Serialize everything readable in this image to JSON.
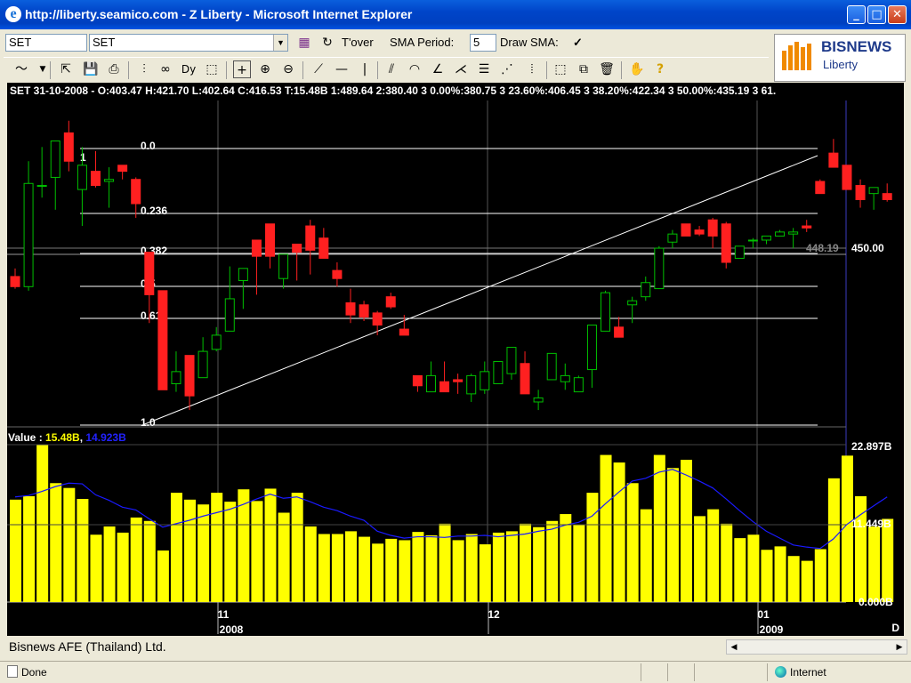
{
  "window": {
    "title": "http://liberty.seamico.com - Z Liberty - Microsoft Internet Explorer"
  },
  "toolbar": {
    "symbol_input": "SET",
    "symbol_select": "SET",
    "tover_label": "T'over",
    "sma_period_label": "SMA Period:",
    "sma_period_value": "5",
    "draw_sma_label": "Draw SMA:",
    "draw_sma_checked": "✓"
  },
  "logo": {
    "brand": "BISNEWS",
    "sub": "Liberty"
  },
  "info_line": "SET 31-10-2008 - O:403.47 H:421.70 L:402.64 C:416.53 T:15.48B 1:489.64 2:380.40 3 0.00%:380.75 3 23.60%:406.45 3 38.20%:422.34 3 50.00%:435.19 3 61.",
  "fib_labels": [
    "0.0",
    "0.236",
    "0.382",
    "0.5",
    "0.618",
    "1.0"
  ],
  "fib_marker": "1",
  "cursor_value": "448.19",
  "price_axis_label": "450.00",
  "volume": {
    "legend_prefix": "Value : ",
    "value": "15.48B",
    "sma": "14.923B",
    "axis_labels": [
      "22.897B",
      "11.449B",
      "0.000B"
    ]
  },
  "x_axis": {
    "ticks": [
      "11",
      "12",
      "01"
    ],
    "years": [
      "2008",
      "2009"
    ],
    "end_label": "D"
  },
  "chart_data": {
    "type": "candlestick",
    "candles": [
      {
        "o": 423,
        "h": 427,
        "l": 417,
        "c": 418
      },
      {
        "o": 418,
        "h": 480,
        "l": 416,
        "c": 469
      },
      {
        "o": 468,
        "h": 487,
        "l": 462,
        "c": 468
      },
      {
        "o": 472,
        "h": 482,
        "l": 456,
        "c": 490
      },
      {
        "o": 494,
        "h": 500,
        "l": 475,
        "c": 480
      },
      {
        "o": 466,
        "h": 487,
        "l": 448,
        "c": 478
      },
      {
        "o": 475,
        "h": 485,
        "l": 467,
        "c": 468
      },
      {
        "o": 470,
        "h": 477,
        "l": 457,
        "c": 471
      },
      {
        "o": 478,
        "h": 478,
        "l": 471,
        "c": 475
      },
      {
        "o": 471,
        "h": 472,
        "l": 452,
        "c": 459
      },
      {
        "o": 435,
        "h": 435,
        "l": 400,
        "c": 414
      },
      {
        "o": 416,
        "h": 416,
        "l": 396,
        "c": 367
      },
      {
        "o": 370,
        "h": 386,
        "l": 366,
        "c": 376
      },
      {
        "o": 384,
        "h": 384,
        "l": 357,
        "c": 364
      },
      {
        "o": 373,
        "h": 393,
        "l": 373,
        "c": 386
      },
      {
        "o": 387,
        "h": 398,
        "l": 386,
        "c": 394
      },
      {
        "o": 396,
        "h": 428,
        "l": 396,
        "c": 412
      },
      {
        "o": 421,
        "h": 427,
        "l": 407,
        "c": 427
      },
      {
        "o": 441,
        "h": 441,
        "l": 414,
        "c": 433
      },
      {
        "o": 449,
        "h": 449,
        "l": 427,
        "c": 433
      },
      {
        "o": 422,
        "h": 427,
        "l": 417,
        "c": 434
      },
      {
        "o": 439,
        "h": 439,
        "l": 421,
        "c": 435
      },
      {
        "o": 448,
        "h": 451,
        "l": 424,
        "c": 436
      },
      {
        "o": 442,
        "h": 447,
        "l": 434,
        "c": 432
      },
      {
        "o": 426,
        "h": 430,
        "l": 418,
        "c": 422
      },
      {
        "o": 410,
        "h": 417,
        "l": 400,
        "c": 404
      },
      {
        "o": 409,
        "h": 411,
        "l": 401,
        "c": 403
      },
      {
        "o": 405,
        "h": 406,
        "l": 394,
        "c": 399
      },
      {
        "o": 413,
        "h": 415,
        "l": 407,
        "c": 408
      },
      {
        "o": 397,
        "h": 404,
        "l": 396,
        "c": 394
      },
      {
        "o": 374,
        "h": 374,
        "l": 366,
        "c": 369
      },
      {
        "o": 366,
        "h": 381,
        "l": 366,
        "c": 374
      },
      {
        "o": 371,
        "h": 381,
        "l": 369,
        "c": 366
      },
      {
        "o": 372,
        "h": 375,
        "l": 365,
        "c": 371
      },
      {
        "o": 365,
        "h": 375,
        "l": 361,
        "c": 374
      },
      {
        "o": 367,
        "h": 381,
        "l": 365,
        "c": 376
      },
      {
        "o": 370,
        "h": 381,
        "l": 370,
        "c": 381
      },
      {
        "o": 375,
        "h": 385,
        "l": 372,
        "c": 388
      },
      {
        "o": 380,
        "h": 386,
        "l": 371,
        "c": 365
      },
      {
        "o": 361,
        "h": 367,
        "l": 357,
        "c": 363
      },
      {
        "o": 372,
        "h": 385,
        "l": 372,
        "c": 385
      },
      {
        "o": 371,
        "h": 380,
        "l": 367,
        "c": 374
      },
      {
        "o": 366,
        "h": 374,
        "l": 366,
        "c": 373
      },
      {
        "o": 377,
        "h": 376,
        "l": 368,
        "c": 399
      },
      {
        "o": 396,
        "h": 416,
        "l": 399,
        "c": 415
      },
      {
        "o": 398,
        "h": 403,
        "l": 399,
        "c": 393
      },
      {
        "o": 409,
        "h": 413,
        "l": 400,
        "c": 411
      },
      {
        "o": 413,
        "h": 423,
        "l": 411,
        "c": 420
      },
      {
        "o": 417,
        "h": 438,
        "l": 419,
        "c": 437
      },
      {
        "o": 440,
        "h": 446,
        "l": 437,
        "c": 444
      },
      {
        "o": 449,
        "h": 449,
        "l": 446,
        "c": 443
      },
      {
        "o": 446,
        "h": 448,
        "l": 443,
        "c": 444
      },
      {
        "o": 451,
        "h": 452,
        "l": 437,
        "c": 443
      },
      {
        "o": 449,
        "h": 450,
        "l": 427,
        "c": 430
      },
      {
        "o": 432,
        "h": 438,
        "l": 432,
        "c": 438
      },
      {
        "o": 441,
        "h": 442,
        "l": 437,
        "c": 441
      },
      {
        "o": 441,
        "h": 443,
        "l": 439,
        "c": 443
      },
      {
        "o": 443,
        "h": 446,
        "l": 444,
        "c": 445
      },
      {
        "o": 444,
        "h": 447,
        "l": 437,
        "c": 445
      },
      {
        "o": 448,
        "h": 451,
        "l": 445,
        "c": 447
      },
      {
        "o": 470,
        "h": 471,
        "l": 464,
        "c": 464
      },
      {
        "o": 484,
        "h": 491,
        "l": 479,
        "c": 477
      },
      {
        "o": 478,
        "h": 478,
        "l": 466,
        "c": 466
      },
      {
        "o": 468,
        "h": 471,
        "l": 457,
        "c": 461
      },
      {
        "o": 464,
        "h": 467,
        "l": 456,
        "c": 467
      },
      {
        "o": 464,
        "h": 469,
        "l": 460,
        "c": 461
      }
    ],
    "volume_values": [
      14.9,
      15.4,
      22.9,
      17.3,
      16.6,
      15.0,
      9.8,
      11.0,
      10.1,
      12.3,
      11.8,
      7.5,
      15.9,
      14.9,
      14.2,
      15.9,
      14.6,
      16.4,
      14.7,
      16.5,
      13.0,
      15.9,
      11.0,
      9.9,
      9.9,
      10.3,
      9.5,
      8.5,
      9.2,
      9.0,
      10.2,
      9.7,
      11.4,
      9.0,
      9.9,
      8.4,
      10.1,
      10.3,
      11.4,
      10.9,
      11.8,
      12.8,
      11.3,
      15.9,
      21.4,
      20.3,
      17.3,
      13.5,
      21.4,
      19.5,
      20.7,
      12.5,
      13.5,
      11.4,
      9.3,
      9.8,
      7.6,
      8.1,
      6.7,
      6.0,
      7.7,
      18.0,
      21.3,
      15.4,
      11.0,
      12.1
    ],
    "sma_values": [
      15.3,
      15.5,
      16.1,
      16.8,
      17.3,
      17.2,
      15.6,
      14.8,
      13.8,
      13.4,
      12.1,
      10.9,
      11.4,
      11.9,
      12.5,
      13.0,
      13.5,
      14.2,
      15.0,
      15.7,
      15.1,
      15.3,
      14.6,
      13.8,
      13.3,
      12.5,
      11.9,
      10.3,
      9.7,
      9.3,
      9.5,
      9.5,
      9.4,
      9.6,
      9.6,
      9.7,
      9.5,
      9.7,
      9.9,
      10.3,
      10.6,
      11.2,
      11.6,
      12.5,
      14.3,
      16.0,
      17.6,
      18.0,
      18.9,
      19.3,
      18.5,
      17.6,
      16.6,
      15.0,
      13.3,
      11.7,
      10.3,
      9.3,
      8.3,
      8.0,
      7.8,
      9.2,
      11.3,
      12.7,
      14.0,
      15.3
    ],
    "price_ylim": [
      350,
      510
    ],
    "volume_ylim": [
      0,
      22.897
    ],
    "grid": true
  }
}
